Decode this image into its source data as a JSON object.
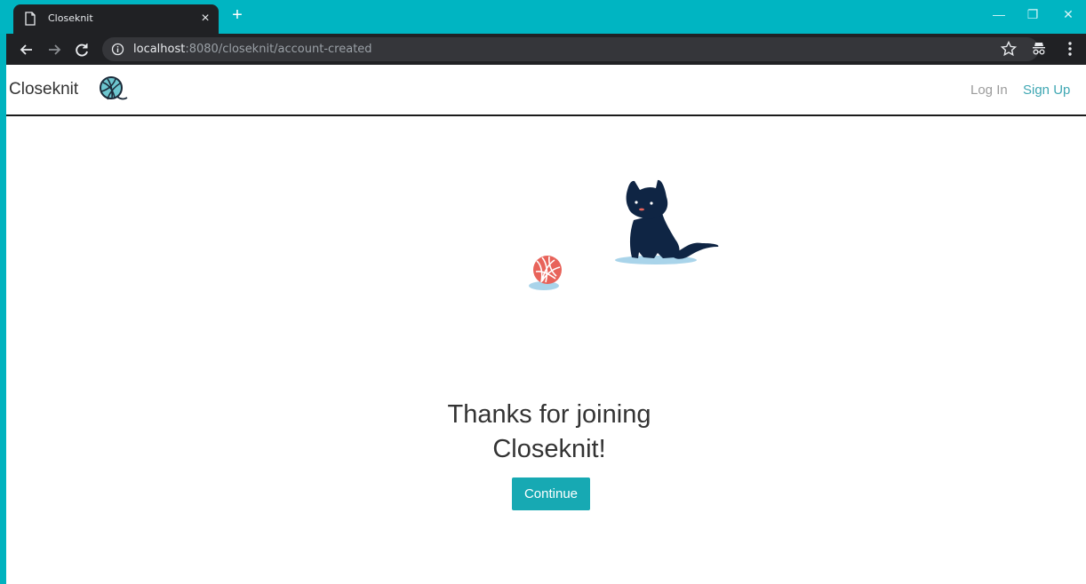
{
  "browser": {
    "tab_title": "Closeknit",
    "tab_close_label": "×",
    "new_tab_label": "+",
    "url_host": "localhost",
    "url_path": ":8080/closeknit/account-created",
    "window_controls": {
      "minimize": "—",
      "restore": "❐",
      "close": "✕"
    },
    "icons": [
      "page-icon",
      "back-arrow-icon",
      "forward-arrow-icon",
      "reload-icon",
      "info-icon",
      "star-icon",
      "incognito-icon",
      "more-menu-icon"
    ]
  },
  "nav": {
    "brand": "Closeknit",
    "brand_logo_icon": "yarn-ball-icon",
    "login": "Log In",
    "signup": "Sign Up"
  },
  "main": {
    "headline_line1": "Thanks for joining",
    "headline_line2": "Closeknit!",
    "continue_label": "Continue"
  },
  "colors": {
    "tab_strip": "#00b5c2",
    "chrome_dark": "#202124",
    "accent": "#17a9b3",
    "signup_link": "#3fa7b3",
    "cat": "#0f2544",
    "yarn": "#e8635a",
    "shadow": "#a9d4ea"
  }
}
